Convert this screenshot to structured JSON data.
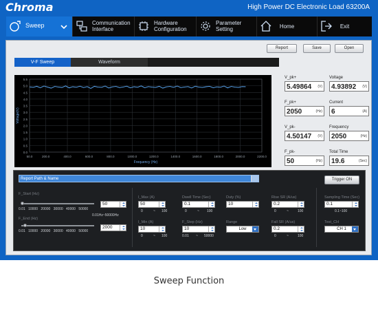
{
  "header": {
    "brand": "Chroma",
    "product": "High Power DC Electronic Load 63200A"
  },
  "nav": {
    "sweep": "Sweep",
    "communication": [
      "Communication",
      "Interface"
    ],
    "hardware": [
      "Hardware",
      "Configuration"
    ],
    "parameter": [
      "Parameter",
      "Setting"
    ],
    "home": "Home",
    "exit": "Exit"
  },
  "toolbar": {
    "report": "Report",
    "save": "Save",
    "open": "Open"
  },
  "tabs": {
    "vf_sweep": "V-F Sweep",
    "waveform": "Waveform"
  },
  "chart_data": {
    "type": "line",
    "xlabel": "Frequency (Hz)",
    "ylabel": "Voltage(V)",
    "x_ticks": [
      "50.0",
      "200.0",
      "400.0",
      "600.0",
      "800.0",
      "1000.0",
      "1200.0",
      "1400.0",
      "1600.0",
      "1800.0",
      "2000.0",
      "2200.0"
    ],
    "y_ticks": [
      "5.5",
      "5.0",
      "4.5",
      "4.0",
      "3.5",
      "3.0",
      "2.5",
      "2.0",
      "1.5",
      "1.0",
      "0.5",
      "0.0"
    ],
    "xlim": [
      50,
      2200
    ],
    "ylim": [
      0,
      5.5
    ],
    "grid": true,
    "series": [
      {
        "x_range": [
          50,
          2050
        ],
        "values": [
          4.92,
          4.88,
          4.96,
          4.85,
          4.98,
          4.9,
          4.82,
          4.95,
          4.91,
          4.87,
          4.99,
          4.84,
          4.93,
          4.89,
          4.97,
          4.86,
          4.94,
          4.8,
          4.96,
          4.9,
          4.88,
          4.98,
          4.83,
          4.92,
          4.95,
          4.86,
          4.91,
          4.97,
          4.84,
          4.93,
          4.89,
          4.99,
          4.85,
          4.94,
          4.9,
          4.87,
          4.96,
          4.82,
          4.92,
          4.95,
          4.88,
          4.98,
          4.86,
          4.91,
          4.94,
          4.83,
          4.97,
          4.9,
          4.87,
          4.93,
          4.96,
          4.85,
          4.92,
          4.89,
          4.98,
          4.84,
          4.95,
          4.9,
          4.87,
          4.94,
          4.93
        ]
      }
    ]
  },
  "measurements": [
    {
      "label": "V_pk+",
      "value": "5.49864",
      "unit": "(V)"
    },
    {
      "label": "Voltage",
      "value": "4.93892",
      "unit": "(V)"
    },
    {
      "label": "F_pk+",
      "value": "2050",
      "unit": "(Hz)"
    },
    {
      "label": "Current",
      "value": "6",
      "unit": "(A)"
    },
    {
      "label": "V_pk-",
      "value": "4.50147",
      "unit": "(V)"
    },
    {
      "label": "Frequency",
      "value": "2050",
      "unit": "(Hz)"
    },
    {
      "label": "F_pk-",
      "value": "50",
      "unit": "(Hz)"
    },
    {
      "label": "Total Time",
      "value": "19.6",
      "unit": "(Sec)"
    }
  ],
  "controls": {
    "report_path": "Report Path & Name",
    "trigger": "Trigger ON",
    "f_start": {
      "label": "F_Start (Hz)",
      "value": "50"
    },
    "f_end": {
      "label": "F_End (Hz)",
      "value": "2000",
      "note": "0.01Hz~50000Hz"
    },
    "scale": [
      "0.01",
      "10000",
      "20000",
      "30000",
      "40000",
      "50000"
    ],
    "i_max": {
      "label": "I_Max (A)",
      "value": "50",
      "min": "0",
      "max": "100"
    },
    "i_min": {
      "label": "I_Min (A)",
      "value": "10",
      "min": "0",
      "max": "100"
    },
    "dwell": {
      "label": "Dwell Time (Sec)",
      "value": "0.1",
      "min": "0",
      "max": "100"
    },
    "f_step": {
      "label": "F_Step (Hz)",
      "value": "10",
      "min": "0.01",
      "max": "50000"
    },
    "duty": {
      "label": "Duty (%)",
      "value": "10"
    },
    "range": {
      "label": "Range",
      "value": "Low"
    },
    "rise_sr": {
      "label": "Rise SR (A/us)",
      "value": "0.2",
      "min": "0",
      "max": "100"
    },
    "fall_sr": {
      "label": "Fall SR (A/us)",
      "value": "0.2",
      "min": "0",
      "max": "100"
    },
    "sampling": {
      "label": "Sampling Time (Sec)",
      "value": "0.1",
      "note": "0.1~100"
    },
    "test_ch": {
      "label": "Test_CH",
      "value": "CH 1"
    }
  },
  "caption": "Sweep Function"
}
